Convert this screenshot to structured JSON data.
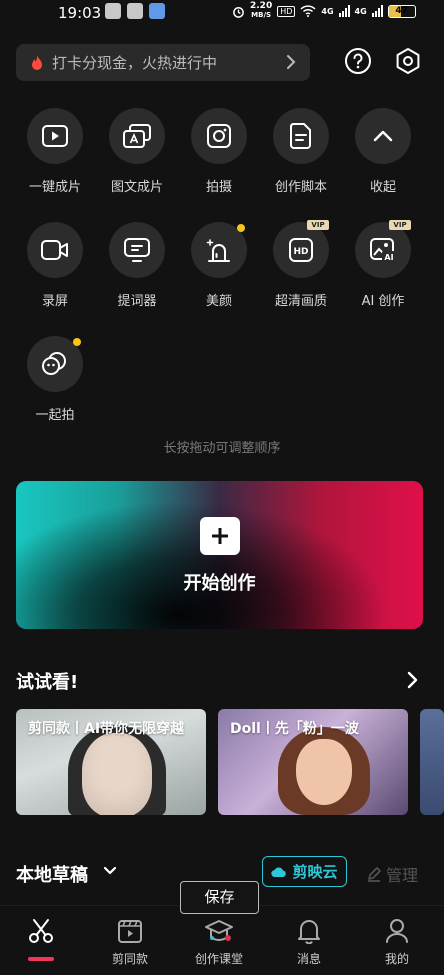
{
  "status_bar": {
    "time": "19:03",
    "speed_value": "2.20",
    "speed_unit": "MB/S",
    "hd_badge": "HD",
    "network_1": "4G",
    "network_2": "4G",
    "battery_level": "47",
    "battery_fraction": 0.47
  },
  "search": {
    "text": "打卡分现金，火热进行中"
  },
  "tools": [
    {
      "label": "一键成片",
      "icon": "play-icon",
      "badge": ""
    },
    {
      "label": "图文成片",
      "icon": "text-to-video-icon",
      "badge": ""
    },
    {
      "label": "拍摄",
      "icon": "camera-icon",
      "badge": ""
    },
    {
      "label": "创作脚本",
      "icon": "script-icon",
      "badge": ""
    },
    {
      "label": "收起",
      "icon": "chevron-up-icon",
      "badge": ""
    },
    {
      "label": "录屏",
      "icon": "video-camera-icon",
      "badge": ""
    },
    {
      "label": "提词器",
      "icon": "teleprompter-icon",
      "badge": ""
    },
    {
      "label": "美颜",
      "icon": "beauty-icon",
      "badge": "dot"
    },
    {
      "label": "超清画质",
      "icon": "hd-icon",
      "badge": "VIP"
    },
    {
      "label": "AI 创作",
      "icon": "ai-create-icon",
      "badge": "VIP"
    },
    {
      "label": "一起拍",
      "icon": "shoot-together-icon",
      "badge": "dot"
    }
  ],
  "vip_text": "VIP",
  "hint": "长按拖动可调整顺序",
  "banner": {
    "title": "开始创作"
  },
  "try_section": {
    "title": "试试看!",
    "cards": [
      {
        "text": "剪同款丨AI带你无限穿越"
      },
      {
        "text": "Doll丨先「粉」一波"
      }
    ]
  },
  "drafts": {
    "title": "本地草稿",
    "cloud_label": "剪映云",
    "manage_label": "管理"
  },
  "save_tooltip": "保存",
  "bottom_nav": [
    {
      "label": "",
      "icon": "scissors-icon",
      "active": true
    },
    {
      "label": "剪同款",
      "icon": "template-icon",
      "active": false
    },
    {
      "label": "创作课堂",
      "icon": "graduation-cap-icon",
      "active": false
    },
    {
      "label": "消息",
      "icon": "bell-icon",
      "active": false
    },
    {
      "label": "我的",
      "icon": "profile-icon",
      "active": false
    }
  ],
  "colors": {
    "accent_cyan": "#2fc6d8",
    "accent_red": "#f2365a",
    "dot_yellow": "#f5c518"
  }
}
